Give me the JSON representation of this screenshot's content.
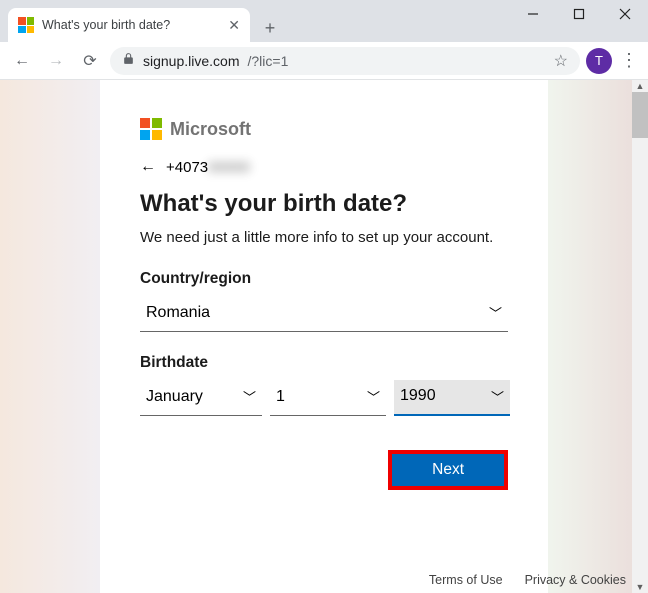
{
  "window": {
    "tab_title": "What's your birth date?",
    "avatar_initial": "T"
  },
  "address": {
    "host": "signup.live.com",
    "path": "/?lic=1"
  },
  "brand": "Microsoft",
  "identity": {
    "prefix": "+4073",
    "obscured": "00000"
  },
  "heading": "What's your birth date?",
  "subtext": "We need just a little more info to set up your account.",
  "labels": {
    "country": "Country/region",
    "birthdate": "Birthdate"
  },
  "values": {
    "country": "Romania",
    "month": "January",
    "day": "1",
    "year": "1990"
  },
  "buttons": {
    "next": "Next"
  },
  "footer": {
    "terms": "Terms of Use",
    "privacy": "Privacy & Cookies"
  },
  "colors": {
    "ms_red": "#f25022",
    "ms_green": "#7fba00",
    "ms_blue": "#00a4ef",
    "ms_yellow": "#ffb900"
  }
}
